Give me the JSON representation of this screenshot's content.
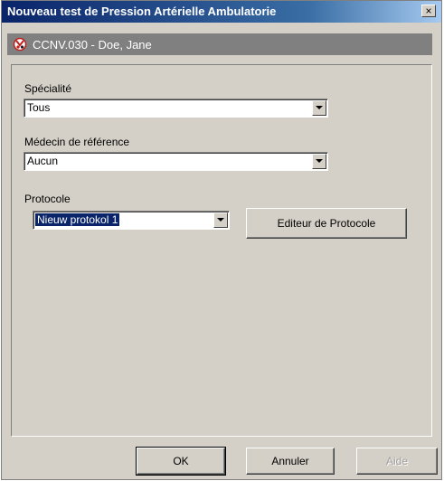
{
  "window": {
    "title": "Nouveau test de Pression Artérielle Ambulatorie",
    "close_label": "×"
  },
  "patient": {
    "label": "CCNV.030 - Doe, Jane",
    "icon": "patient-icon"
  },
  "form": {
    "specialty": {
      "label": "Spécialité",
      "value": "Tous"
    },
    "referring_physician": {
      "label": "Médecin de référence",
      "value": "Aucun"
    },
    "protocol": {
      "label": "Protocole",
      "value": "Nieuw protokol 1"
    },
    "protocol_editor_label": "Editeur de Protocole"
  },
  "footer": {
    "ok_label": "OK",
    "cancel_label": "Annuler",
    "help_label": "Aide"
  },
  "colors": {
    "titlebar": "#0a246a",
    "face": "#d4d0c8",
    "patient_bar": "#808080",
    "selection": "#0a246a"
  }
}
